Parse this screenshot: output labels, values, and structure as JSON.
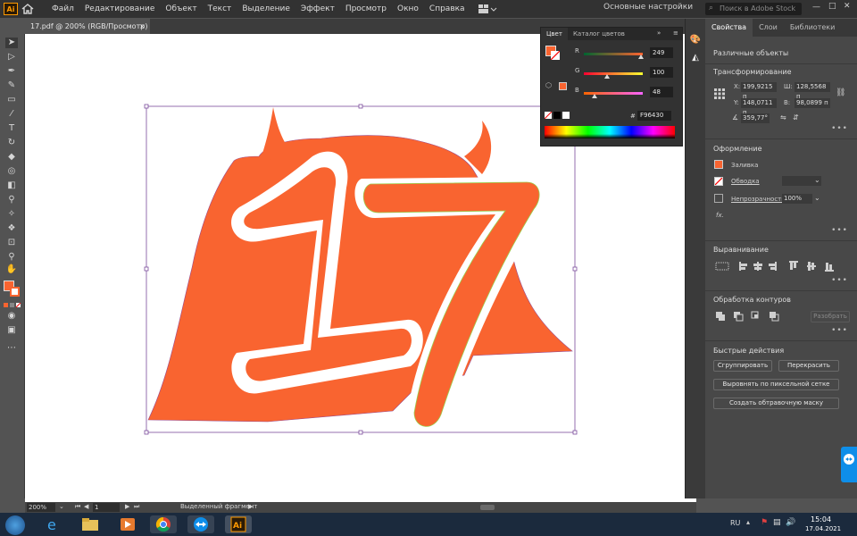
{
  "app": {
    "logo": "Ai",
    "menu": [
      "Файл",
      "Редактирование",
      "Объект",
      "Текст",
      "Выделение",
      "Эффект",
      "Просмотр",
      "Окно",
      "Справка"
    ],
    "workspace": "Основные настройки",
    "stock_placeholder": "Поиск в Adobe Stock"
  },
  "document": {
    "tab_title": "17.pdf @ 200% (RGB/Просмотр)",
    "tab_close": "×"
  },
  "color_panel": {
    "tabs": [
      "Цвет",
      "Каталог цветов"
    ],
    "channels": [
      {
        "label": "R",
        "value": "249",
        "fraction": 0.976,
        "gradient": "linear-gradient(90deg,#006430,#ff6430)"
      },
      {
        "label": "G",
        "value": "100",
        "fraction": 0.392,
        "gradient": "linear-gradient(90deg,#f90030,#f9ff30)"
      },
      {
        "label": "B",
        "value": "48",
        "fraction": 0.188,
        "gradient": "linear-gradient(90deg,#f96400,#f964ff)"
      }
    ],
    "hex_symbol": "#",
    "hex": "F96430",
    "fill_color": "#f96430"
  },
  "properties": {
    "tabs": [
      "Свойства",
      "Слои",
      "Библиотеки"
    ],
    "selection_type": "Различные объекты",
    "transform": {
      "title": "Трансформирование",
      "x_label": "X:",
      "x": "199,9215 п",
      "y_label": "Y:",
      "y": "148,0711 п",
      "w_label": "Ш:",
      "w": "128,5568 п",
      "h_label": "В:",
      "h": "98,0899 п",
      "angle": "359,77°"
    },
    "appearance": {
      "title": "Оформление",
      "fill": "Заливка",
      "stroke": "Обводка",
      "opacity": "Непрозрачность",
      "opacity_value": "100%",
      "fx": "fx."
    },
    "align_title": "Выравнивание",
    "pathfinder_title": "Обработка контуров",
    "pathfinder_expand": "Разобрать",
    "quick_actions": {
      "title": "Быстрые действия",
      "group": "Сгруппировать",
      "recolor": "Перекрасить",
      "align_pixel": "Выровнять по пиксельной сетке",
      "clip_mask": "Создать обтравочную маску"
    },
    "more": "•••"
  },
  "status": {
    "zoom": "200%",
    "artboard": "1",
    "selection_label": "Выделенный фрагмент"
  },
  "taskbar": {
    "lang": "RU",
    "time": "15:04",
    "date": "17.04.2021"
  },
  "colors": {
    "accent": "#f96430",
    "selection": "#7b4c9c",
    "bg_panel": "#484848"
  }
}
